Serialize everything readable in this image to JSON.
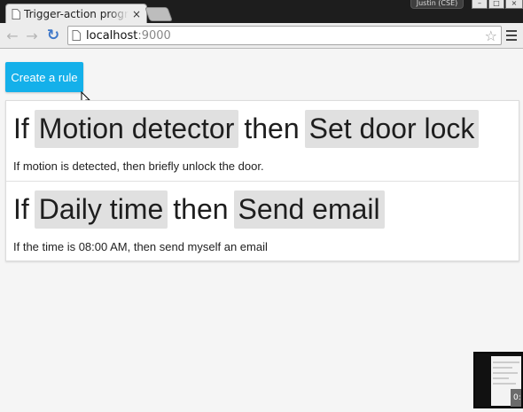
{
  "browser": {
    "tab_title": "Trigger-action progr",
    "tab_close": "×",
    "user_name": "Justin (CSE)",
    "window_minimize": "–",
    "window_maximize": "□",
    "window_close": "×",
    "url_host": "localhost",
    "url_port": ":9000",
    "back_glyph": "←",
    "forward_glyph": "→",
    "reload_glyph": "↻",
    "star_glyph": "☆"
  },
  "page": {
    "create_rule_label": "Create a rule",
    "rules": [
      {
        "if_word": "If",
        "trigger": "Motion detector",
        "then_word": "then",
        "action": "Set door lock",
        "description": "If motion is detected, then briefly unlock the door."
      },
      {
        "if_word": "If",
        "trigger": "Daily time",
        "then_word": "then",
        "action": "Send email",
        "description": "If the time is 08:00 AM, then send myself an email"
      }
    ]
  },
  "overlay": {
    "time_text": "0:"
  },
  "colors": {
    "primary_button": "#14b0ea",
    "chip_background": "#e0e0e0",
    "reload_icon": "#3f78c9"
  }
}
